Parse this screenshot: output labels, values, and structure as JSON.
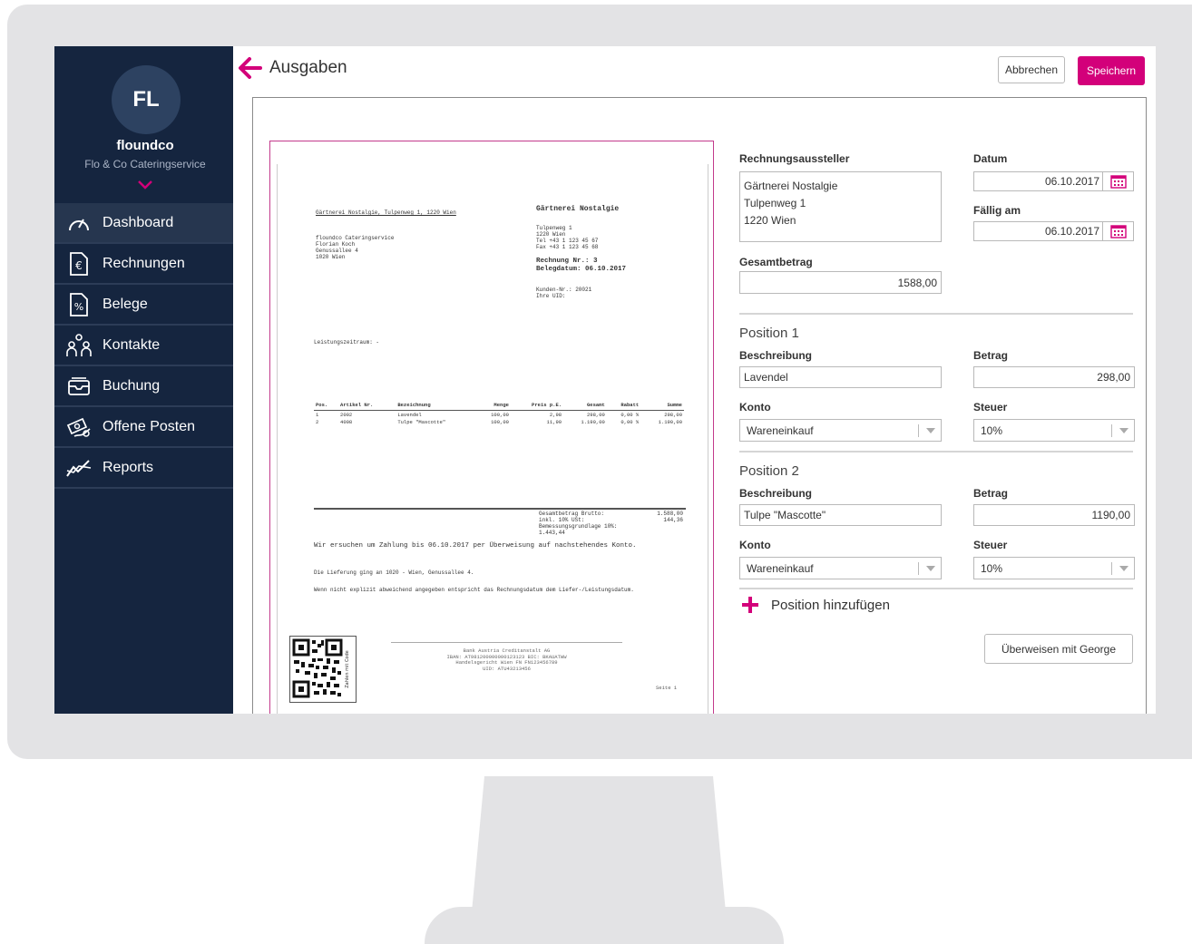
{
  "sidebar": {
    "avatar_initials": "FL",
    "company_name": "floundco",
    "company_subtitle": "Flo & Co Cateringservice",
    "items": [
      {
        "label": "Dashboard",
        "icon": "gauge-icon"
      },
      {
        "label": "Rechnungen",
        "icon": "euro-document-icon"
      },
      {
        "label": "Belege",
        "icon": "percent-document-icon"
      },
      {
        "label": "Kontakte",
        "icon": "people-icon"
      },
      {
        "label": "Buchung",
        "icon": "inbox-icon"
      },
      {
        "label": "Offene Posten",
        "icon": "money-hand-icon"
      },
      {
        "label": "Reports",
        "icon": "trend-chart-icon"
      }
    ],
    "active_item": "Dashboard"
  },
  "header": {
    "title": "Ausgaben",
    "cancel_label": "Abbrechen",
    "save_label": "Speichern"
  },
  "invoice": {
    "sender_line": "Gärtnerei Nostalgie, Tulpenweg 1, 1220 Wien",
    "recipient_address": "floundco Cateringservice\nFlorian Koch\nGenussallee 4\n1020 Wien",
    "issuer_name": "Gärtnerei Nostalgie",
    "issuer_address": "Tulpenweg 1\n1220 Wien\nTel +43 1 123 45 67\nFax +43 1 123 45 68",
    "invoice_meta": "Rechnung Nr.: 3\nBelegdatum: 06.10.2017",
    "customer_meta": "Kunden-Nr.: 20021\nIhre UID:",
    "period_label": "Leistungszeitraum: -",
    "table_headers": [
      "Pos.",
      "Artikel Nr.",
      "Bezeichnung",
      "Menge",
      "Preis p.E.",
      "Gesamt",
      "Rabatt",
      "Summe"
    ],
    "table_rows": [
      [
        "1",
        "2002",
        "Lavendel",
        "100,00",
        "2,98",
        "298,00",
        "0,00 %",
        "298,00"
      ],
      [
        "2",
        "4008",
        "Tulpe \"Mascotte\"",
        "100,00",
        "11,90",
        "1.190,00",
        "0,00 %",
        "1.190,00"
      ]
    ],
    "sum_labels": "Gesamtbetrag Brutto:\ninkl. 10% USt:\nBemessungsgrundlage 10%:\n1.443,44",
    "sum_values": "1.588,00\n144,36",
    "closing_text": "Wir ersuchen um Zahlung bis 06.10.2017 per Überweisung auf nachstehendes Konto.",
    "delivery_text": "Die Lieferung ging an 1020 - Wien, Genussallee 4.",
    "note_text": "Wenn nicht explizit abweichend angegeben entspricht das Rechnungsdatum dem Liefer-/Leistungsdatum.",
    "qr_label": "Zahlen mit Code",
    "bank_text": "Bank Austria Creditanstalt AG\nIBAN: AT981200000000123123 BIC: BKAUATWW\nHandelsgericht Wien FN FN123456789\nUID: ATU43213456",
    "page_label": "Seite 1"
  },
  "form": {
    "issuer_label": "Rechnungsaussteller",
    "issuer_value": "Gärtnerei Nostalgie\nTulpenweg 1\n1220 Wien",
    "date_label": "Datum",
    "date_value": "06.10.2017",
    "due_label": "Fällig am",
    "due_value": "06.10.2017",
    "total_label": "Gesamtbetrag",
    "total_value": "1588,00",
    "positions": [
      {
        "title": "Position 1",
        "desc_label": "Beschreibung",
        "desc_value": "Lavendel",
        "amount_label": "Betrag",
        "amount_value": "298,00",
        "account_label": "Konto",
        "account_value": "Wareneinkauf",
        "tax_label": "Steuer",
        "tax_value": "10%"
      },
      {
        "title": "Position 2",
        "desc_label": "Beschreibung",
        "desc_value": "Tulpe \"Mascotte\"",
        "amount_label": "Betrag",
        "amount_value": "1190,00",
        "account_label": "Konto",
        "account_value": "Wareneinkauf",
        "tax_label": "Steuer",
        "tax_value": "10%"
      }
    ],
    "add_position_label": "Position hinzufügen",
    "transfer_label": "Überweisen mit George"
  },
  "colors": {
    "accent": "#d3007a",
    "sidebar_bg": "#15253f",
    "frame": "#e3e3e5"
  }
}
